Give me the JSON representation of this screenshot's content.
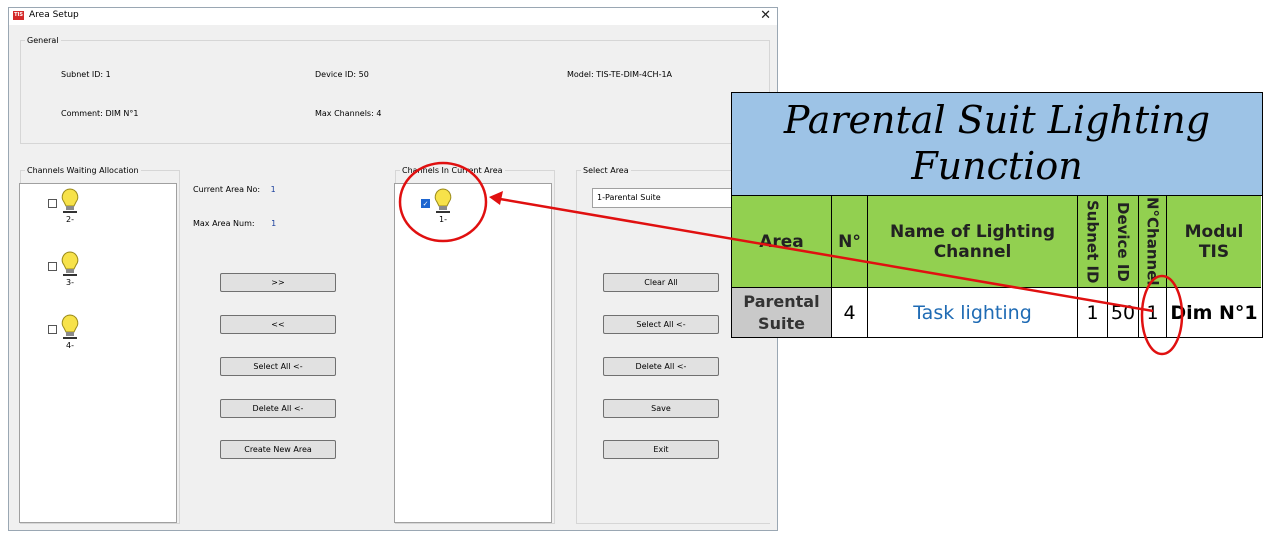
{
  "window": {
    "title": "Area Setup",
    "icon_text": "TIS",
    "close_glyph": "✕"
  },
  "general": {
    "label": "General",
    "subnet_id_label": "Subnet ID:",
    "subnet_id": "1",
    "device_id_label": "Device ID:",
    "device_id": "50",
    "model_label": "Model:",
    "model": "TIS-TE-DIM-4CH-1A",
    "comment_label": "Comment:",
    "comment": "DIM N°1",
    "max_channels_label": "Max Channels:",
    "max_channels": "4"
  },
  "waiting": {
    "label": "Channels Waiting Allocation",
    "items": [
      {
        "label": "2-",
        "checked": false
      },
      {
        "label": "3-",
        "checked": false
      },
      {
        "label": "4-",
        "checked": false
      }
    ]
  },
  "area_info": {
    "current_area_label": "Current Area No:",
    "current_area": "1",
    "max_area_label": "Max Area Num:",
    "max_area": "1"
  },
  "middle_buttons": {
    "move_right": ">>",
    "move_left": "<<",
    "select_all": "Select All <-",
    "delete_all": "Delete All <-",
    "create_new": "Create New Area"
  },
  "current": {
    "label": "Channels In Current Area",
    "items": [
      {
        "label": "1-",
        "checked": true
      }
    ]
  },
  "select_area": {
    "label": "Select Area",
    "value": "1-Parental Suite"
  },
  "right_buttons": {
    "clear_all": "Clear All",
    "select_all": "Select All <-",
    "delete_all": "Delete All <-",
    "save": "Save",
    "exit": "Exit"
  },
  "card": {
    "title": "Parental Suit Lighting Function",
    "headers": {
      "area": "Area",
      "no": "N°",
      "name": "Name of Lighting Channel",
      "subnet": "Subnet ID",
      "device": "Device ID",
      "channel": "N°Channel",
      "module": "Modul TIS"
    },
    "row": {
      "area": "Parental Suite",
      "no": "4",
      "name": "Task lighting",
      "subnet": "1",
      "device": "50",
      "channel": "1",
      "module": "Dim N°1"
    },
    "colors": {
      "title_bg": "#9dc3e6",
      "header_bg": "#92d050",
      "area_cell_bg": "#c9c9c9",
      "link": "#1f6bb4"
    }
  },
  "annotation_color": "#e01010"
}
